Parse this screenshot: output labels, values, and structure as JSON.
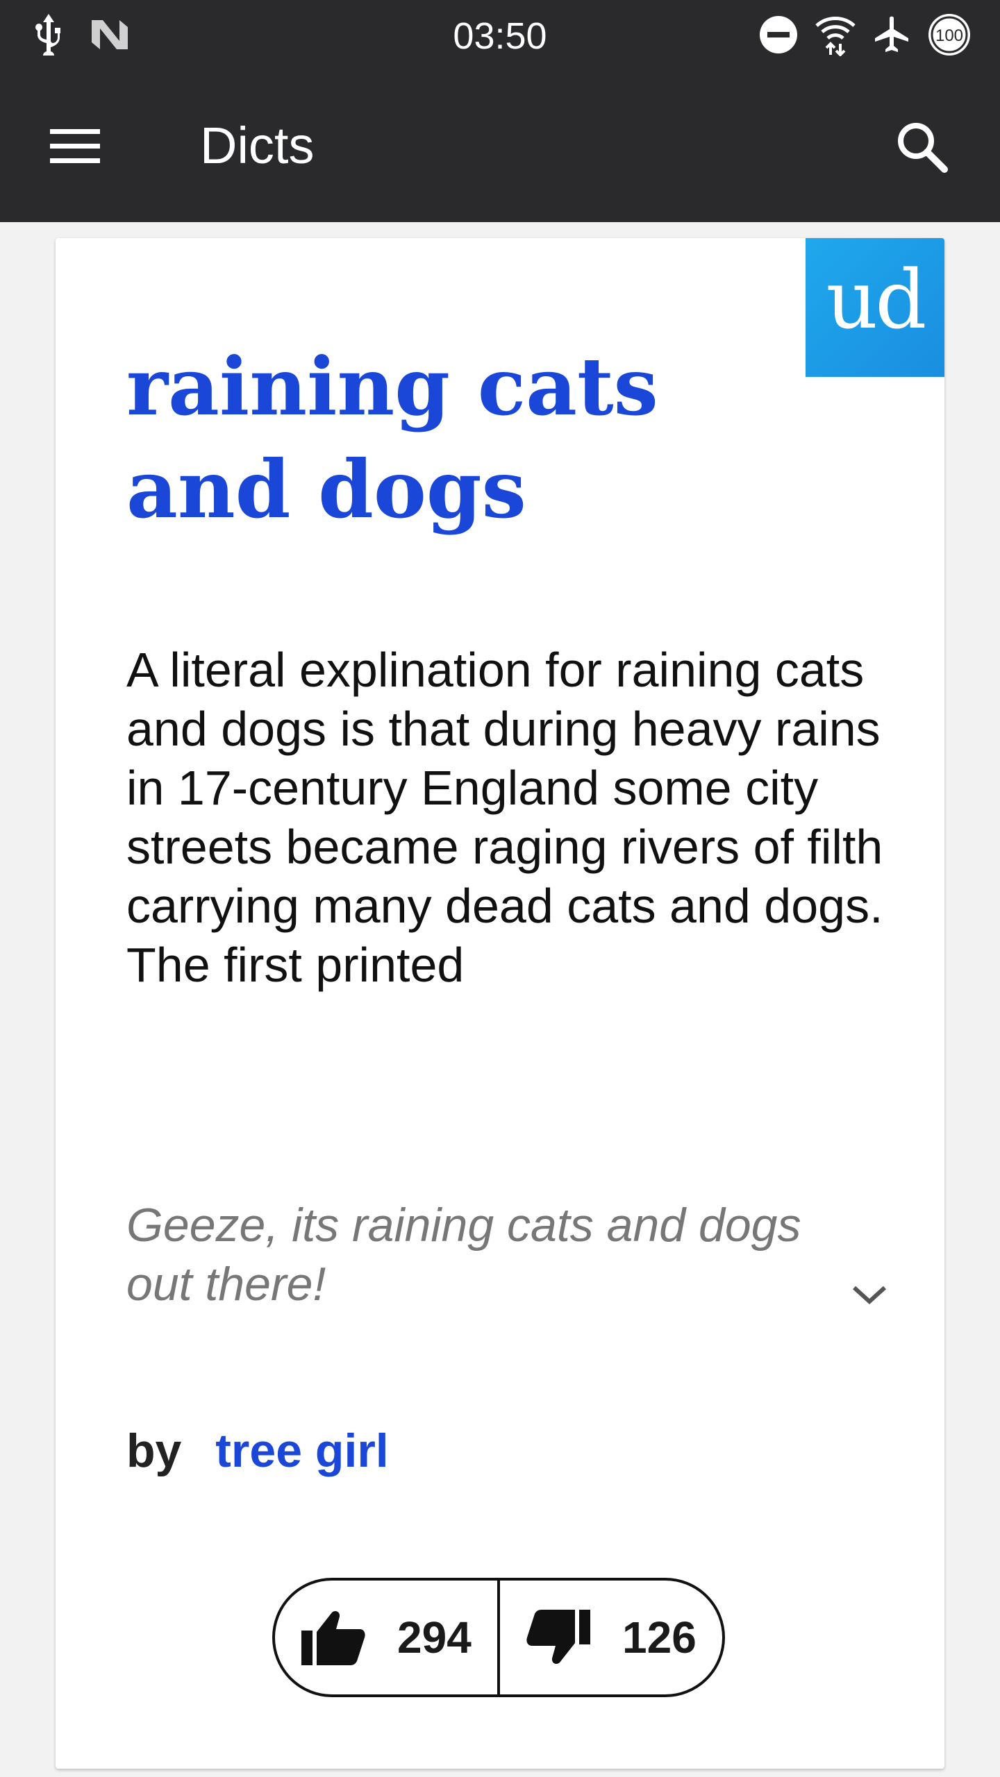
{
  "status_bar": {
    "time": "03:50",
    "left_icons": [
      "usb-icon",
      "nfc-icon"
    ],
    "right_icons": [
      "do-not-disturb-icon",
      "wifi-icon",
      "airplane-mode-icon",
      "battery-icon"
    ],
    "battery_label": "100"
  },
  "app_bar": {
    "title": "Dicts",
    "menu_icon": "hamburger-menu-icon",
    "search_icon": "search-icon"
  },
  "entry": {
    "source_badge": "ud",
    "word": "raining cats and dogs",
    "definition": "A literal explination for raining cats and dogs is that during heavy rains in 17-century England some city streets became raging rivers of filth carrying many dead cats and dogs.  The first printed",
    "example": "Geeze, its raining cats and dogs out there!",
    "by_label": "by",
    "author": "tree girl",
    "thumbs_up": "294",
    "thumbs_down": "126"
  },
  "colors": {
    "app_bar": "#2a2a2c",
    "accent_blue": "#1a47d8",
    "badge_blue": "#1d9be6",
    "background": "#f2f2f2"
  }
}
